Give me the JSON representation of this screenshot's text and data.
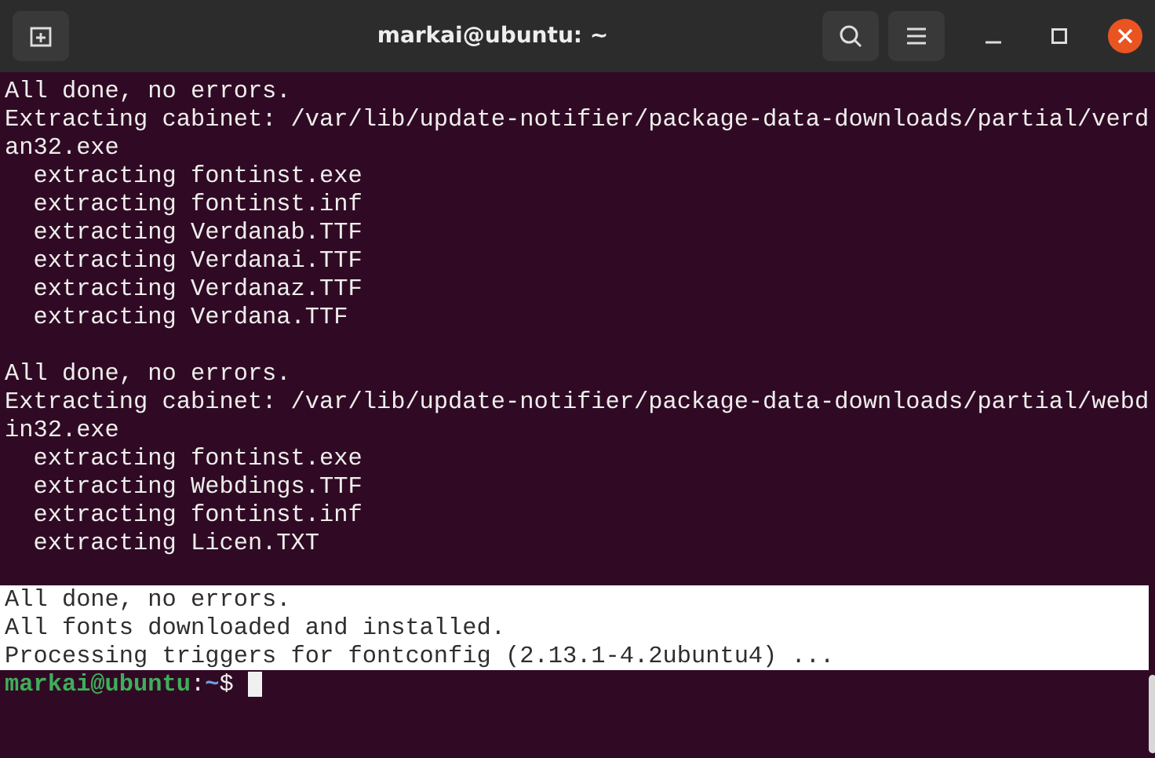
{
  "window": {
    "title": "markai@ubuntu: ~"
  },
  "terminal": {
    "lines": [
      {
        "kind": "text",
        "text": "All done, no errors.",
        "selected": false
      },
      {
        "kind": "text",
        "text": "Extracting cabinet: /var/lib/update-notifier/package-data-downloads/partial/verd",
        "selected": false
      },
      {
        "kind": "text",
        "text": "an32.exe",
        "selected": false
      },
      {
        "kind": "text",
        "text": "  extracting fontinst.exe",
        "selected": false
      },
      {
        "kind": "text",
        "text": "  extracting fontinst.inf",
        "selected": false
      },
      {
        "kind": "text",
        "text": "  extracting Verdanab.TTF",
        "selected": false
      },
      {
        "kind": "text",
        "text": "  extracting Verdanai.TTF",
        "selected": false
      },
      {
        "kind": "text",
        "text": "  extracting Verdanaz.TTF",
        "selected": false
      },
      {
        "kind": "text",
        "text": "  extracting Verdana.TTF",
        "selected": false
      },
      {
        "kind": "blank"
      },
      {
        "kind": "text",
        "text": "All done, no errors.",
        "selected": false
      },
      {
        "kind": "text",
        "text": "Extracting cabinet: /var/lib/update-notifier/package-data-downloads/partial/webd",
        "selected": false
      },
      {
        "kind": "text",
        "text": "in32.exe",
        "selected": false
      },
      {
        "kind": "text",
        "text": "  extracting fontinst.exe",
        "selected": false
      },
      {
        "kind": "text",
        "text": "  extracting Webdings.TTF",
        "selected": false
      },
      {
        "kind": "text",
        "text": "  extracting fontinst.inf",
        "selected": false
      },
      {
        "kind": "text",
        "text": "  extracting Licen.TXT",
        "selected": false
      },
      {
        "kind": "blank"
      },
      {
        "kind": "text",
        "text": "All done, no errors.",
        "selected": true
      },
      {
        "kind": "text",
        "text": "All fonts downloaded and installed.",
        "selected": true
      },
      {
        "kind": "text",
        "text": "Processing triggers for fontconfig (2.13.1-4.2ubuntu4) ...",
        "selected": true
      }
    ],
    "prompt": {
      "user_host": "markai@ubuntu",
      "separator": ":",
      "path": "~",
      "symbol": "$"
    }
  }
}
